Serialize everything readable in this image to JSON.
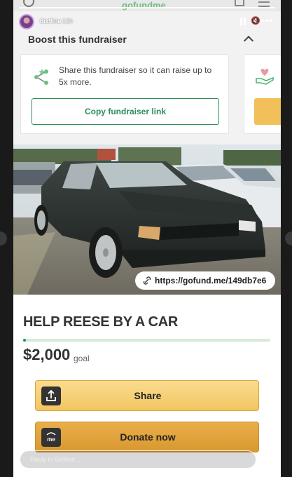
{
  "story": {
    "username": "6ix9ine",
    "time": "12h",
    "header_brand": "gofundme",
    "reply_placeholder": "Reply to 6ix9ine..."
  },
  "boost": {
    "title": "Boost this fundraiser",
    "description": "Share this fundraiser so it can raise up to 5x more.",
    "copy_link_label": "Copy fundraiser link"
  },
  "campaign": {
    "url": "https://gofund.me/149db7e6",
    "title": "HELP REESE BY A CAR",
    "amount": "$2,000",
    "goal_label": "goal",
    "progress_fraction": 0.01
  },
  "actions": {
    "share_label": "Share",
    "donate_label": "Donate now",
    "donate_icon_text": "me"
  },
  "colors": {
    "brand_green": "#2e8f5a",
    "share_yellow": "#f4c560",
    "donate_orange": "#d99830"
  }
}
